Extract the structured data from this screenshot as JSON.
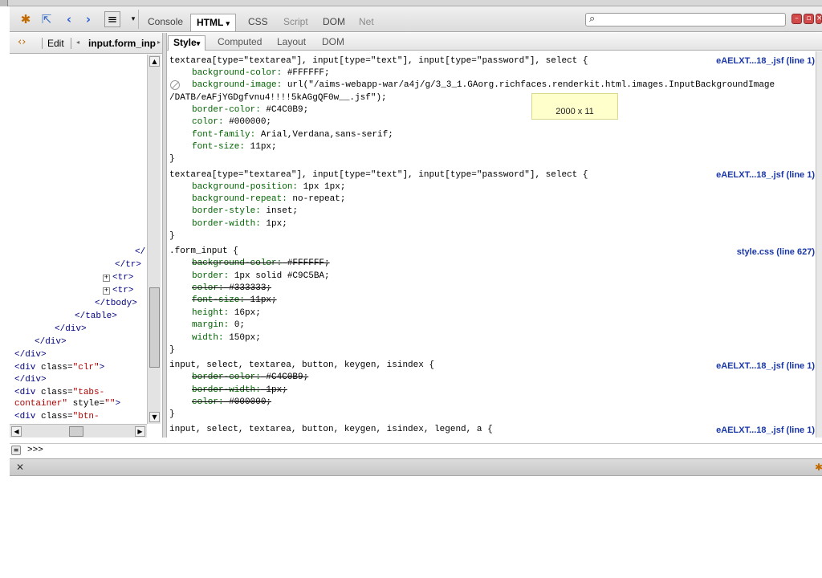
{
  "toolbar": {
    "tabs": {
      "console": "Console",
      "html": "HTML",
      "css": "CSS",
      "script": "Script",
      "dom": "DOM",
      "net": "Net"
    },
    "search_value": ""
  },
  "left_panel": {
    "edit_label": "Edit",
    "breadcrumb": "input.form_inp",
    "tree": [
      {
        "text": "</t",
        "kind": "close"
      },
      {
        "text": "</tr>",
        "kind": "close"
      },
      {
        "text": "<tr>",
        "kind": "collapsed"
      },
      {
        "text": "<tr>",
        "kind": "collapsed"
      },
      {
        "text": "</tbody>",
        "kind": "close"
      },
      {
        "text": "</table>",
        "kind": "close"
      },
      {
        "text": "</div>",
        "kind": "close"
      },
      {
        "text": "</div>",
        "kind": "close"
      },
      {
        "text": "</div>",
        "kind": "close"
      },
      {
        "text": "<div ",
        "attr": "class=",
        "val": "\"clr\"",
        "end": ">"
      },
      {
        "text": "</div>",
        "kind": "close"
      },
      {
        "text": "<div ",
        "attr": "class=",
        "val": "\"tabs-",
        "end": ""
      },
      {
        "text": "",
        "val": "container\"",
        "attr": " style=",
        "val2": "\"\"",
        "end": ">"
      },
      {
        "text": "<div ",
        "attr": "class=",
        "val": "\"btn-",
        "end": ""
      }
    ]
  },
  "right_panel": {
    "sub_tabs": {
      "style": "Style",
      "computed": "Computed",
      "layout": "Layout",
      "dom": "DOM"
    },
    "tooltip": "2000 x 11",
    "rules": {
      "r1_selector": "textarea[type=\"textarea\"], input[type=\"text\"], input[type=\"password\"], select {",
      "r1_source": "eAELXT...18_.jsf (line 1)",
      "r1_p1_name": "background-color:",
      "r1_p1_val": " #FFFFFF;",
      "r1_p2_name": "background-image:",
      "r1_p2_val": " url(\"/aims-webapp-war/a4j/g/3_3_1.GAorg.richfaces.renderkit.html.images.InputBackgroundImage",
      "r1_p2_cont": "/DATB/eAFjYGDgfvnu4!!!!5kAGgQF0w__.jsf\");",
      "r1_p3_name": "border-color:",
      "r1_p3_val": " #C4C0B9;",
      "r1_p4_name": "color:",
      "r1_p4_val": " #000000;",
      "r1_p5_name": "font-family:",
      "r1_p5_val": " Arial,Verdana,sans-serif;",
      "r1_p6_name": "font-size:",
      "r1_p6_val": " 11px;",
      "r2_selector": "textarea[type=\"textarea\"], input[type=\"text\"], input[type=\"password\"], select {",
      "r2_source": "eAELXT...18_.jsf (line 1)",
      "r2_p1_name": "background-position:",
      "r2_p1_val": " 1px 1px;",
      "r2_p2_name": "background-repeat:",
      "r2_p2_val": " no-repeat;",
      "r2_p3_name": "border-style:",
      "r2_p3_val": " inset;",
      "r2_p4_name": "border-width:",
      "r2_p4_val": " 1px;",
      "r3_selector": ".form_input {",
      "r3_source": "style.css (line 627)",
      "r3_p1_name": "background-color:",
      "r3_p1_val": " #FFFFFF;",
      "r3_p2_name": "border:",
      "r3_p2_val": " 1px solid #C9C5BA;",
      "r3_p3_name": "color:",
      "r3_p3_val": " #333333;",
      "r3_p4_name": "font-size:",
      "r3_p4_val": " 11px;",
      "r3_p5_name": "height:",
      "r3_p5_val": " 16px;",
      "r3_p6_name": "margin:",
      "r3_p6_val": " 0;",
      "r3_p7_name": "width:",
      "r3_p7_val": " 150px;",
      "r4_selector": "input, select, textarea, button, keygen, isindex {",
      "r4_source": "eAELXT...18_.jsf (line 1)",
      "r4_p1_name": "border-color:",
      "r4_p1_val": " #C4C0B9;",
      "r4_p2_name": "border-width:",
      "r4_p2_val": " 1px;",
      "r4_p3_name": "color:",
      "r4_p3_val": " #000000;",
      "r5_selector": "input, select, textarea, button, keygen, isindex, legend, a {",
      "r5_source": "eAELXT...18_.jsf (line 1)",
      "close_brace": "}"
    }
  },
  "command_line": {
    "prompt": ">>>"
  },
  "colors": {
    "link": "#1a37a8",
    "prop_name": "#006400",
    "tag": "#000080",
    "attr_value": "#b00000",
    "tooltip_bg": "#ffffcc"
  }
}
